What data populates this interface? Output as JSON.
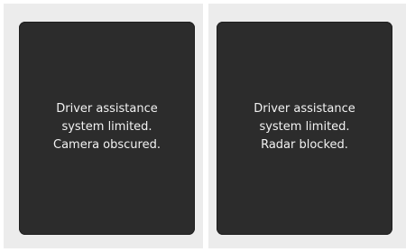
{
  "panels": [
    {
      "lines": [
        "Driver assistance",
        "system limited.",
        "Camera obscured."
      ]
    },
    {
      "lines": [
        "Driver assistance",
        "system limited.",
        "Radar blocked."
      ]
    }
  ]
}
